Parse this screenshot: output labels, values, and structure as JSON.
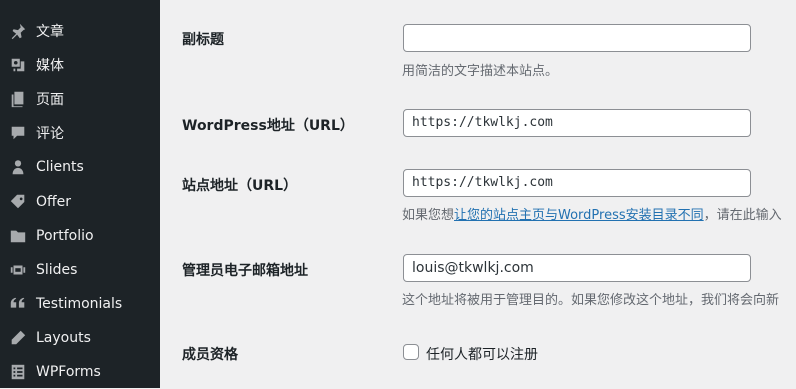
{
  "sidebar": {
    "items": [
      {
        "label": "文章",
        "icon": "pin-icon"
      },
      {
        "label": "媒体",
        "icon": "media-icon"
      },
      {
        "label": "页面",
        "icon": "page-icon"
      },
      {
        "label": "评论",
        "icon": "comment-icon"
      },
      {
        "label": "Clients",
        "icon": "user-icon"
      },
      {
        "label": "Offer",
        "icon": "tag-icon"
      },
      {
        "label": "Portfolio",
        "icon": "folder-icon"
      },
      {
        "label": "Slides",
        "icon": "slides-icon"
      },
      {
        "label": "Testimonials",
        "icon": "quote-icon"
      },
      {
        "label": "Layouts",
        "icon": "edit-icon"
      },
      {
        "label": "WPForms",
        "icon": "forms-icon"
      }
    ]
  },
  "settings": {
    "tagline": {
      "label": "副标题",
      "value": "",
      "description": "用简洁的文字描述本站点。"
    },
    "wp_address": {
      "label": "WordPress地址（URL）",
      "value": "https://tkwlkj.com"
    },
    "site_address": {
      "label": "站点地址（URL）",
      "value": "https://tkwlkj.com",
      "description_prefix": "如果您想",
      "description_link": "让您的站点主页与WordPress安装目录不同",
      "description_suffix": "，请在此输入"
    },
    "admin_email": {
      "label": "管理员电子邮箱地址",
      "value": "louis@tkwlkj.com",
      "description": "这个地址将被用于管理目的。如果您修改这个地址，我们将会向新"
    },
    "membership": {
      "label": "成员资格",
      "checkbox_label": "任何人都可以注册",
      "checked": false
    }
  }
}
